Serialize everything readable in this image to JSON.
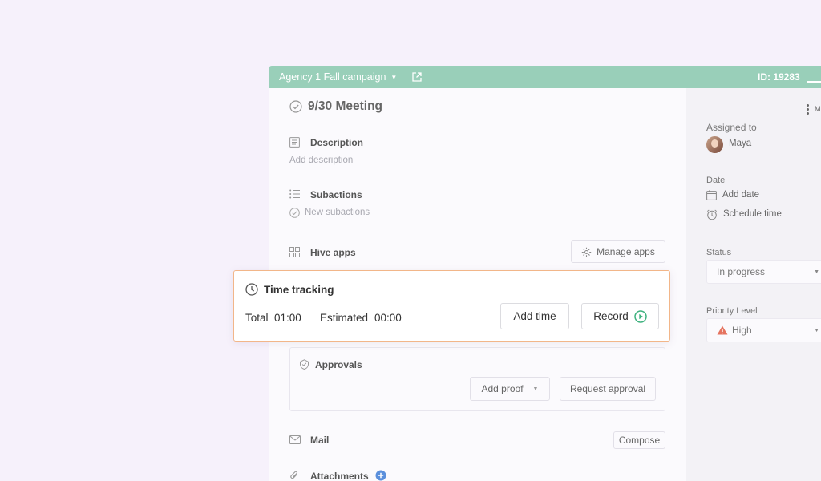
{
  "header": {
    "project": "Agency 1 Fall campaign",
    "id_label": "ID: 19283"
  },
  "task": {
    "title": "9/30 Meeting"
  },
  "sections": {
    "description_label": "Description",
    "description_placeholder": "Add description",
    "subactions_label": "Subactions",
    "subactions_placeholder": "New subactions",
    "hive_apps_label": "Hive apps",
    "manage_apps_label": "Manage apps",
    "approvals_label": "Approvals",
    "add_proof_label": "Add proof",
    "request_approval_label": "Request approval",
    "mail_label": "Mail",
    "compose_label": "Compose",
    "attachments_label": "Attachments"
  },
  "sidebar": {
    "more_label": "M",
    "assigned_label": "Assigned to",
    "assignee": "Maya",
    "date_label": "Date",
    "add_date": "Add date",
    "schedule_time": "Schedule time",
    "status_label": "Status",
    "status_value": "In progress",
    "priority_label": "Priority Level",
    "priority_value": "High"
  },
  "time_tracking": {
    "title": "Time tracking",
    "total_label": "Total",
    "total_value": "01:00",
    "estimated_label": "Estimated",
    "estimated_value": "00:00",
    "add_time_label": "Add time",
    "record_label": "Record"
  },
  "colors": {
    "header_bg": "#99cfb9",
    "popup_border": "#f2b689",
    "record_green": "#3fb27f",
    "priority_high": "#e5735f",
    "attach_plus": "#5b8fdc"
  }
}
